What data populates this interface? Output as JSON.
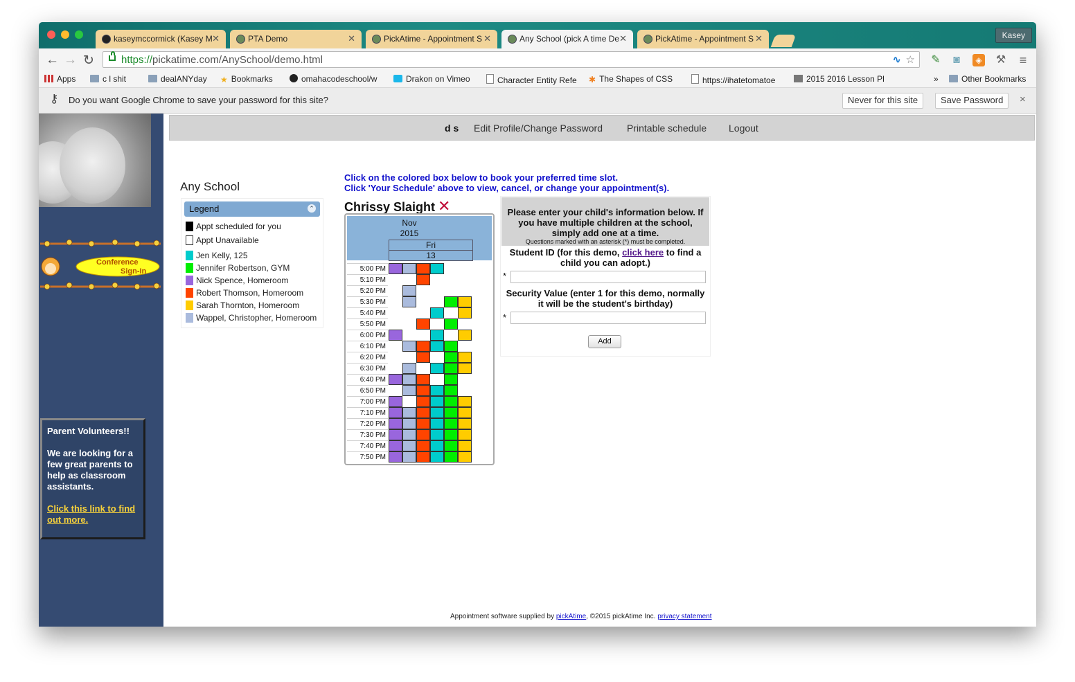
{
  "browser": {
    "tabs": [
      {
        "title": "kaseymccormick (Kasey M"
      },
      {
        "title": "PTA Demo"
      },
      {
        "title": "PickAtime - Appointment S"
      },
      {
        "title": "Any School (pick A time De"
      },
      {
        "title": "PickAtime - Appointment S"
      }
    ],
    "profile": "Kasey",
    "url_scheme": "https://",
    "url_rest": "pickatime.com/AnySchool/demo.html",
    "bookmarks": [
      "Apps",
      "c   l shit",
      "dealANYday",
      "Bookmarks",
      "omahacodeschool/w",
      "Drakon on Vimeo",
      "Character Entity Refe",
      "The Shapes of CSS",
      "https://ihatetomatoe",
      "2015 2016 Lesson Pl",
      "»",
      "Other Bookmarks"
    ],
    "password_prompt": "Do you want Google Chrome to save your password for this site?",
    "never_label": "Never for this site",
    "save_label": "Save Password",
    "close_glyph": "×"
  },
  "nav": {
    "user": "d s",
    "edit_profile": "Edit Profile/Change Password",
    "printable": "Printable schedule",
    "logout": "Logout"
  },
  "sidebar": {
    "conference_line1": "Conference",
    "conference_line2": "Sign-In",
    "vol_title": "Parent Volunteers!!",
    "vol_text": "We are looking for a few great parents to help as classroom assistants.",
    "vol_link": "Click this link to find out more."
  },
  "school": {
    "name": "Any School"
  },
  "legend": {
    "title": "Legend",
    "items": [
      {
        "label": "Appt scheduled for you",
        "color": "#000000"
      },
      {
        "label": "Appt Unavailable",
        "color": "#ffffff"
      },
      {
        "label": "Jen Kelly, 125",
        "color": "#00cccc"
      },
      {
        "label": "Jennifer Robertson, GYM",
        "color": "#00ee00"
      },
      {
        "label": "Nick Spence, Homeroom",
        "color": "#9966dd"
      },
      {
        "label": "Robert Thomson, Homeroom",
        "color": "#ff4400"
      },
      {
        "label": "Sarah Thornton, Homeroom",
        "color": "#ffcc00"
      },
      {
        "label": "Wappel, Christopher, Homeroom",
        "color": "#aabbdd"
      }
    ]
  },
  "instructions": {
    "line1": "Click on the colored box below to book your preferred time slot.",
    "line2": "Click 'Your Schedule' above to view, cancel, or change your appointment(s)."
  },
  "teacher": {
    "name": "Chrissy Slaight",
    "remove_glyph": "✕"
  },
  "schedule": {
    "month": "Nov",
    "year": "2015",
    "day": "Fri",
    "date": "13",
    "column_colors": [
      "#9966dd",
      "#aabbdd",
      "#ff4400",
      "#00cccc",
      "#00ee00",
      "#ffcc00"
    ],
    "slots": [
      {
        "time": "5:00 PM",
        "cells": [
          1,
          1,
          1,
          1,
          0,
          0
        ]
      },
      {
        "time": "5:10 PM",
        "cells": [
          0,
          0,
          1,
          0,
          0,
          0
        ]
      },
      {
        "time": "5:20 PM",
        "cells": [
          0,
          1,
          0,
          0,
          0,
          0
        ]
      },
      {
        "time": "5:30 PM",
        "cells": [
          0,
          1,
          0,
          0,
          1,
          1
        ]
      },
      {
        "time": "5:40 PM",
        "cells": [
          0,
          0,
          0,
          1,
          0,
          1
        ]
      },
      {
        "time": "5:50 PM",
        "cells": [
          0,
          0,
          1,
          0,
          1,
          0
        ]
      },
      {
        "time": "6:00 PM",
        "cells": [
          1,
          0,
          0,
          1,
          0,
          1
        ]
      },
      {
        "time": "6:10 PM",
        "cells": [
          0,
          1,
          1,
          1,
          1,
          0
        ]
      },
      {
        "time": "6:20 PM",
        "cells": [
          0,
          0,
          1,
          0,
          1,
          1
        ]
      },
      {
        "time": "6:30 PM",
        "cells": [
          0,
          1,
          0,
          1,
          1,
          1
        ]
      },
      {
        "time": "6:40 PM",
        "cells": [
          1,
          1,
          1,
          0,
          1,
          0
        ]
      },
      {
        "time": "6:50 PM",
        "cells": [
          0,
          1,
          1,
          1,
          1,
          0
        ]
      },
      {
        "time": "7:00 PM",
        "cells": [
          1,
          0,
          1,
          1,
          1,
          1
        ]
      },
      {
        "time": "7:10 PM",
        "cells": [
          1,
          1,
          1,
          1,
          1,
          1
        ]
      },
      {
        "time": "7:20 PM",
        "cells": [
          1,
          1,
          1,
          1,
          1,
          1
        ]
      },
      {
        "time": "7:30 PM",
        "cells": [
          1,
          1,
          1,
          1,
          1,
          1
        ]
      },
      {
        "time": "7:40 PM",
        "cells": [
          1,
          1,
          1,
          1,
          1,
          1
        ]
      },
      {
        "time": "7:50 PM",
        "cells": [
          1,
          1,
          1,
          1,
          1,
          1
        ]
      }
    ]
  },
  "form": {
    "intro": "Please enter your child's information below. If you have multiple children at the school, simply add one at a time.",
    "asterisk_note": "Questions marked with an asterisk (*) must be completed.",
    "student_id_pre": "Student ID (for this demo, ",
    "student_id_link": "click here",
    "student_id_post": " to find a child you can adopt.)",
    "security_label": "Security Value (enter 1 for this demo, normally it will be the student's birthday)",
    "required_mark": "*",
    "add_label": "Add"
  },
  "footer": {
    "text": "Appointment software supplied by ",
    "link1": "pickAtime",
    "text2": ", ©2015 pickAtime Inc. ",
    "link2": "privacy statement"
  }
}
